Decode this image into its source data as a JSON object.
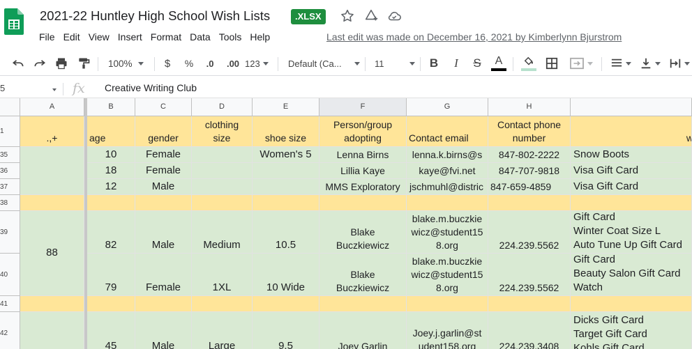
{
  "app": {
    "title": "2021-22 Huntley High School Wish Lists",
    "file_badge": ".XLSX",
    "menu": [
      "File",
      "Edit",
      "View",
      "Insert",
      "Format",
      "Data",
      "Tools",
      "Help"
    ],
    "last_edit": "Last edit was made on December 16, 2021 by Kimberlynn Bjurstrom"
  },
  "toolbar": {
    "zoom": "100%",
    "currency": "$",
    "percent": "%",
    "decimal_decrease": ".0",
    "decimal_increase": ".00",
    "more_formats": "123",
    "font_family": "Default (Ca...",
    "font_size": "11",
    "text_color": "#000000",
    "fill_color": "#b7e1cd"
  },
  "formula_bar": {
    "name_box": "5",
    "value": "Creative Writing Club"
  },
  "columns": [
    "A",
    "B",
    "C",
    "D",
    "E",
    "F",
    "G",
    "H"
  ],
  "header_row": {
    "row_number": "1",
    "a": ".,+",
    "b": "age",
    "c": "gender",
    "d": "clothing size",
    "e": "shoe size",
    "f": "Person/group adopting",
    "g": "Contact email",
    "h": "Contact phone number",
    "i": "w"
  },
  "merged_a": {
    "value": "88"
  },
  "rows": [
    {
      "num": "35",
      "age": "10",
      "gender": "Female",
      "clothing": "",
      "shoe": "Women's 5",
      "adopter": "Lenna Birns",
      "email": "lenna.k.birns@s",
      "phone": "847-802-2222",
      "wishes": [
        "Snow Boots"
      ]
    },
    {
      "num": "36",
      "age": "18",
      "gender": "Female",
      "clothing": "",
      "shoe": "",
      "adopter": "Lillia Kaye",
      "email": "kaye@fvi.net",
      "phone": "847-707-9818",
      "wishes": [
        "Visa Gift Card"
      ]
    },
    {
      "num": "37",
      "age": "12",
      "gender": "Male",
      "clothing": "",
      "shoe": "",
      "adopter": "MMS Exploratory",
      "email": "jschmuhl@distric",
      "phone": "847-659-4859",
      "wishes": [
        "Visa Gift Card"
      ]
    },
    {
      "num": "38"
    },
    {
      "num": "39",
      "age": "82",
      "gender": "Male",
      "clothing": "Medium",
      "shoe": "10.5",
      "adopter": [
        "Blake",
        "Buczkiewicz"
      ],
      "email": [
        "blake.m.buczkie",
        "wicz@student15",
        "8.org"
      ],
      "phone": "224.239.5562",
      "wishes": [
        "Gift Card",
        "Winter Coat Size L",
        "Auto Tune Up Gift Card"
      ]
    },
    {
      "num": "40",
      "age": "79",
      "gender": "Female",
      "clothing": "1XL",
      "shoe": "10 Wide",
      "adopter": [
        "Blake",
        "Buczkiewicz"
      ],
      "email": [
        "blake.m.buczkie",
        "wicz@student15",
        "8.org"
      ],
      "phone": "224.239.5562",
      "wishes": [
        "Gift Card",
        "Beauty Salon Gift Card",
        "Watch"
      ]
    },
    {
      "num": "41"
    },
    {
      "num": "42",
      "age": "45",
      "gender": "Male",
      "clothing": "Large",
      "shoe": "9.5",
      "adopter": "Joey Garlin",
      "email": [
        "Joey.j.garlin@st",
        "udent158.org"
      ],
      "phone": "224.239.3408",
      "wishes": [
        "Dicks Gift Card",
        "Target Gift Card",
        "Kohls Gift Card"
      ]
    }
  ]
}
